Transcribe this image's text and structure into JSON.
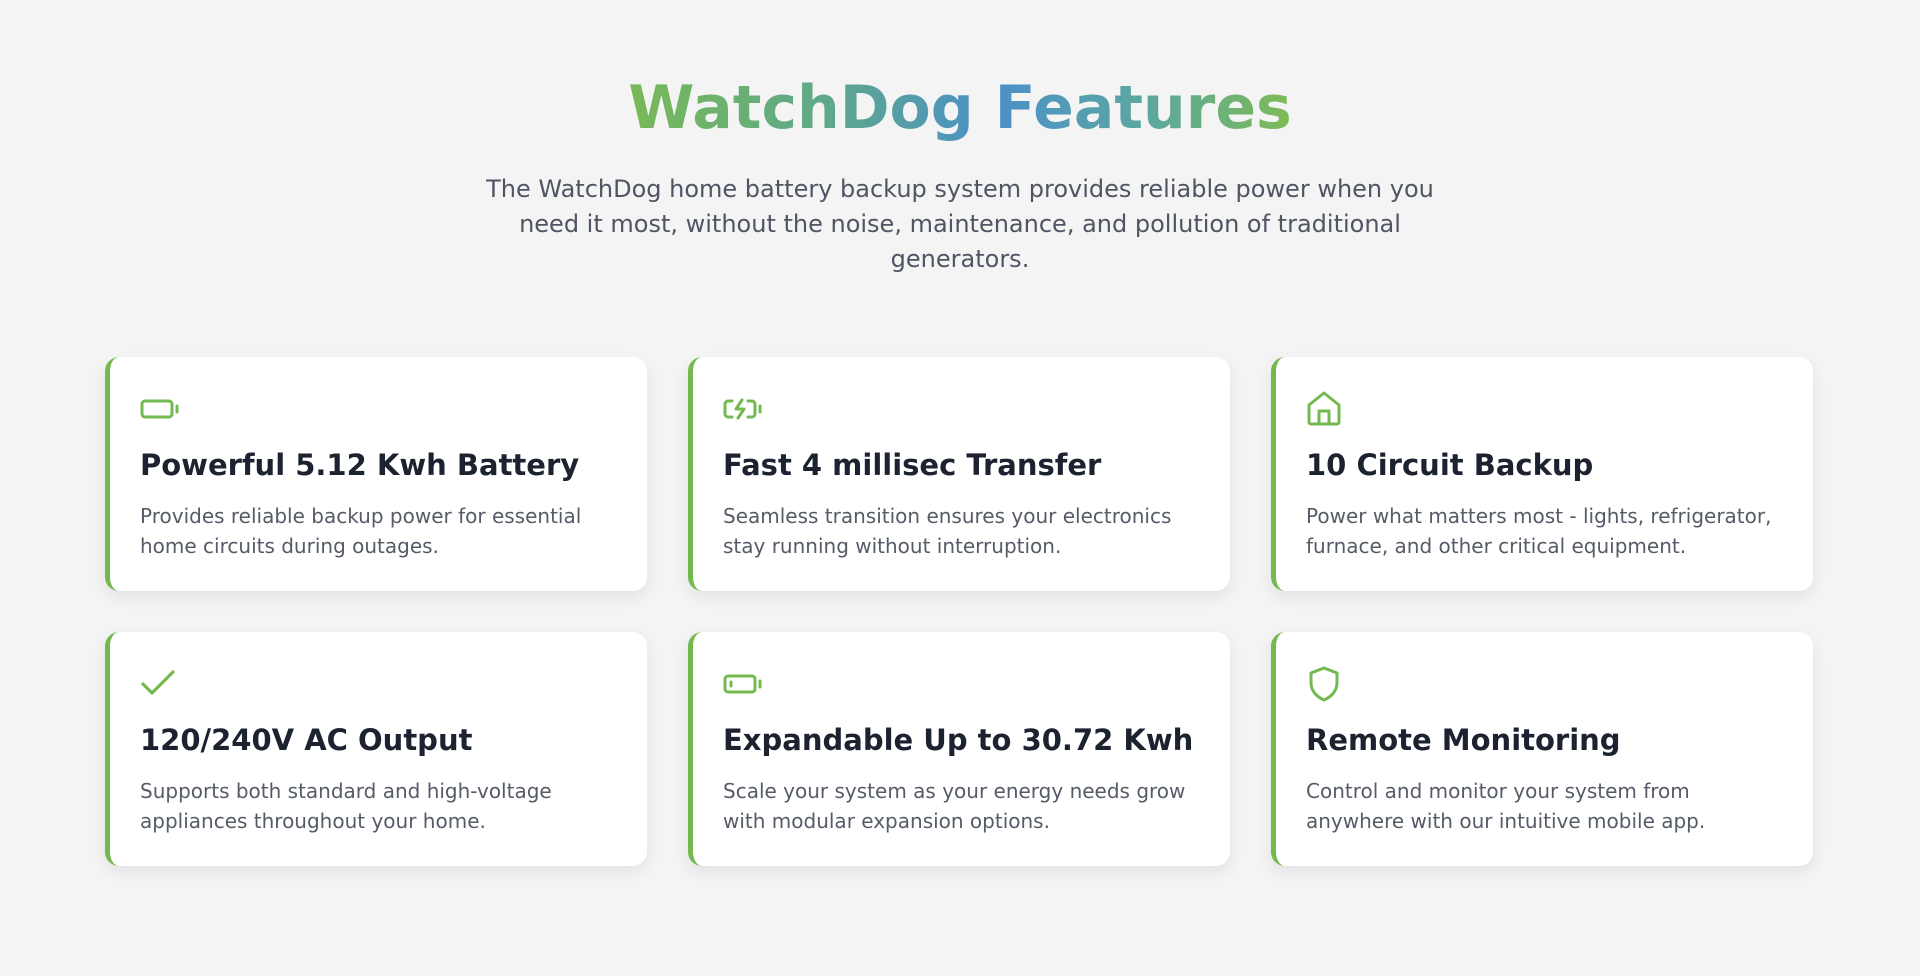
{
  "header": {
    "title": "WatchDog Features",
    "description": "The WatchDog home battery backup system provides reliable power when you need it most, without the noise, maintenance, and pollution of traditional generators."
  },
  "accent_color": "#74b94f",
  "features": [
    {
      "icon": "battery-icon",
      "title": "Powerful 5.12 Kwh Battery",
      "description": "Provides reliable backup power for essential home circuits during outages."
    },
    {
      "icon": "battery-charging-icon",
      "title": "Fast 4 millisec Transfer",
      "description": "Seamless transition ensures your electronics stay running without interruption."
    },
    {
      "icon": "home-icon",
      "title": "10 Circuit Backup",
      "description": "Power what matters most - lights, refrigerator, furnace, and other critical equipment."
    },
    {
      "icon": "check-icon",
      "title": "120/240V AC Output",
      "description": "Supports both standard and high-voltage appliances throughout your home."
    },
    {
      "icon": "battery-icon",
      "title": "Expandable Up to 30.72 Kwh",
      "description": "Scale your system as your energy needs grow with modular expansion options."
    },
    {
      "icon": "shield-icon",
      "title": "Remote Monitoring",
      "description": "Control and monitor your system from anywhere with our intuitive mobile app."
    }
  ]
}
